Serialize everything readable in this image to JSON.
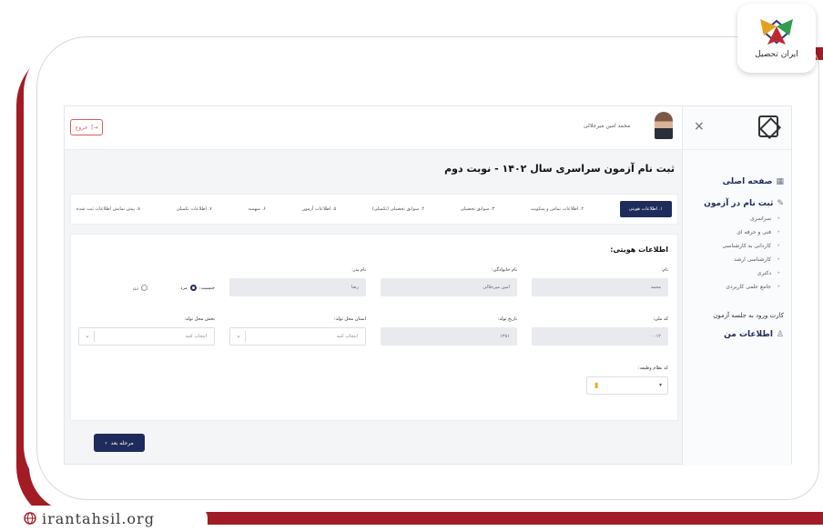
{
  "logo": {
    "text": "ایران تحصیل"
  },
  "watermark": {
    "url": "irantahsil.org"
  },
  "topbar": {
    "user_name": "محمد امین میرجلالی",
    "exit_label": "خروج"
  },
  "sidebar": {
    "home": "صفحه اصلی",
    "register": "ثبت نام در آزمون",
    "sub_items": [
      "سراسری",
      "فنی و حرفه ای",
      "کاردانی به کارشناسی",
      "کارشناسی ارشد",
      "دکتری",
      "جامع علمی کاربردی"
    ],
    "entry_card": "کارت ورود به جلسه آزمون",
    "my_info": "اطلاعات من"
  },
  "page": {
    "title": "ثبت نام آزمون سراسری سال ۱۴۰۲ - نوبت دوم"
  },
  "steps": [
    "۱. اطلاعات هویتی",
    "۲. اطلاعات تماس و سکونت",
    "۳. سوابق تحصیلی",
    "۴. سوابق تحصیلی (تکمیلی)",
    "۵. اطلاعات آزمون",
    "۶. سهمیه",
    "۷. اطلاعات تکمیلی",
    "۸. پیش نمایش اطلاعات ثبت شده"
  ],
  "form": {
    "section_title": "اطلاعات هویتی:",
    "labels": {
      "first_name": "نام:",
      "last_name": "نام خانوادگی:",
      "father_name": "نام پدر:",
      "gender": "جنسیت:",
      "national_code": "کد ملی:",
      "birth_date": "تاریخ تولد:",
      "birth_province": "استان محل تولد:",
      "birth_district": "بخش محل تولد:",
      "duty_status": "کد نظام وظیفه:"
    },
    "values": {
      "first_name": "محمد",
      "last_name": "امین میرجلالی",
      "father_name": "رضا",
      "national_code": "۰۰۱۲",
      "birth_date": "۱۳۸۱"
    },
    "gender_options": [
      "مرد",
      "زن"
    ],
    "select_placeholder": "انتخاب کنید"
  },
  "next_button": "مرحله بعد"
}
